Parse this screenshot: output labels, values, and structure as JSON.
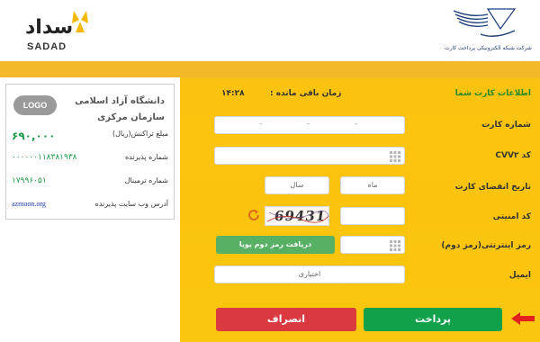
{
  "brand": {
    "sadad_fa": "سداد",
    "sadad_en": "SADAD",
    "shaparak_tagline": "شرکت شبکه الکترونیکی پرداخت کارت"
  },
  "merchant": {
    "logo_text": "LOGO",
    "name": "دانشگاه آزاد اسلامی سازمان مرکزی",
    "amount_label": "مبلغ تراکنش(ریال)",
    "amount_value": "۶۹۰,۰۰۰",
    "terminal_id_label": "شماره پذیرنده",
    "terminal_id_value": "۰۰۰۰۰۰۱۱۸۳۸۱۹۳۸",
    "terminal_label": "شماره ترمینال",
    "terminal_value": "۱۷۹۹۶۰۵۱",
    "website_label": "آدرس وب سایت پذیرنده",
    "website_value": "azmoon.org"
  },
  "form": {
    "section_title": "اطلاعات کارت شما",
    "timer_label": "زمان باقی مانده :",
    "timer_value": "۱۴:۲۸",
    "card_number_label": "شماره کارت",
    "cvv2_label": "کد CVV۲",
    "expiry_label": "تاریخ انقضای کارت",
    "month_placeholder": "ماه",
    "year_placeholder": "سال",
    "security_code_label": "کد امنیتی",
    "captcha_text": "69431",
    "pin2_label": "رمز اینترنتی(رمز دوم)",
    "dynamic_pin_button": "دریافت رمز دوم پویا",
    "email_label": "ایمیل",
    "email_placeholder": "اختیاری"
  },
  "actions": {
    "pay_label": "پرداخت",
    "cancel_label": "انصراف"
  },
  "colors": {
    "panel": "#fbc60e",
    "pay": "#13a04a",
    "cancel": "#d9393f",
    "dynamic_pin": "#58b065",
    "amount": "#1f9b4a"
  }
}
